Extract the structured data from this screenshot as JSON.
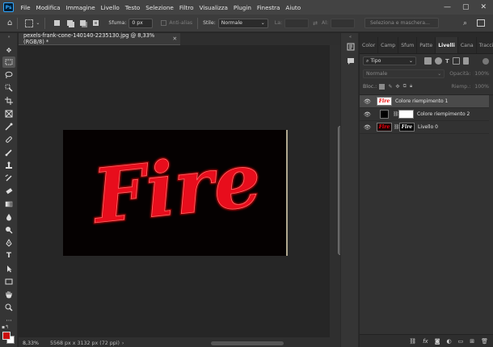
{
  "app": {
    "logo": "Ps"
  },
  "menubar": {
    "items": [
      "File",
      "Modifica",
      "Immagine",
      "Livello",
      "Testo",
      "Selezione",
      "Filtro",
      "Visualizza",
      "Plugin",
      "Finestra",
      "Aiuto"
    ],
    "window_controls": [
      "—",
      "▢",
      "✕"
    ]
  },
  "options": {
    "feather_label": "Sfuma:",
    "feather_value": "0 px",
    "antialias_label": "Anti-alias",
    "style_label": "Stile:",
    "style_value": "Normale",
    "width_label": "La:",
    "height_label": "Al:",
    "select_mask_label": "Seleziona e maschera..."
  },
  "document": {
    "tab_title": "pexels-frank-cone-140140-2235130.jpg @ 8,33% (RGB/8) *",
    "zoom": "8,33%",
    "info": "5568 px x 3132 px (72 ppi)",
    "artwork_text": "Fire",
    "artwork_color": "#e8101e",
    "background_color": "#050101"
  },
  "panel": {
    "tabs": [
      "Color",
      "Camp",
      "Sfum",
      "Patte",
      "Livelli",
      "Cana",
      "Tracci"
    ],
    "active_tab": "Livelli",
    "filter_label": "Tipo",
    "blend_mode": "Normale",
    "opacity_label": "Opacità:",
    "opacity_value": "100%",
    "lock_label": "Bloc.:",
    "fill_label": "Riemp.:",
    "fill_value": "100%",
    "layers": [
      {
        "name": "Colore riempimento 1",
        "selected": true
      },
      {
        "name": "Colore riempimento 2",
        "selected": false
      },
      {
        "name": "Livello 0",
        "selected": false
      }
    ],
    "footer_icons": [
      "link-icon",
      "fx-icon",
      "mask-icon",
      "adjustment-icon",
      "group-icon",
      "new-layer-icon",
      "trash-icon"
    ]
  },
  "colors": {
    "foreground": "#cc0d0d",
    "background": "#ffffff",
    "accent": "#31a8ff"
  }
}
